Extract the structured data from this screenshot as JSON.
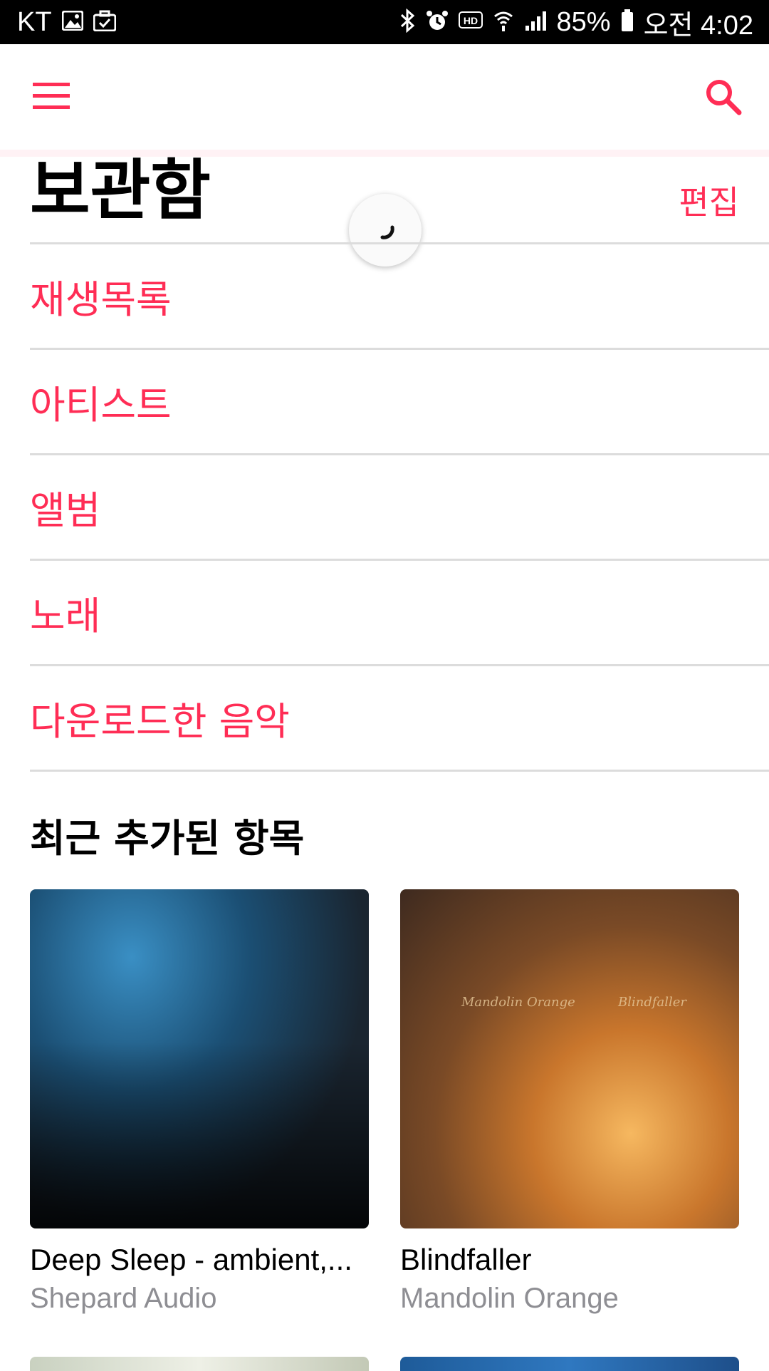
{
  "status_bar": {
    "carrier": "KT",
    "battery": "85%",
    "time": "오전 4:02",
    "icons": [
      "image-icon",
      "briefcase-icon",
      "bluetooth-icon",
      "alarm-icon",
      "hd-icon",
      "wifi-icon",
      "signal-icon",
      "battery-icon"
    ]
  },
  "app_bar": {
    "menu_icon": "menu-icon",
    "search_icon": "search-icon"
  },
  "header": {
    "title": "보관함",
    "edit_label": "편집"
  },
  "library_menu": [
    {
      "label": "재생목록"
    },
    {
      "label": "아티스트"
    },
    {
      "label": "앨범"
    },
    {
      "label": "노래"
    },
    {
      "label": "다운로드한 음악"
    }
  ],
  "recent": {
    "section_title": "최근 추가된 항목",
    "items": [
      {
        "title": "Deep Sleep - ambient,...",
        "artist": "Shepard Audio"
      },
      {
        "title": "Blindfaller",
        "artist": "Mandolin Orange",
        "art_text_left": "Mandolin Orange",
        "art_text_right": "Blindfaller"
      }
    ]
  },
  "colors": {
    "accent": "#ff2d55",
    "status_bar": "#000000",
    "secondary_text": "#8e8e93",
    "divider": "#dcdcdc"
  }
}
